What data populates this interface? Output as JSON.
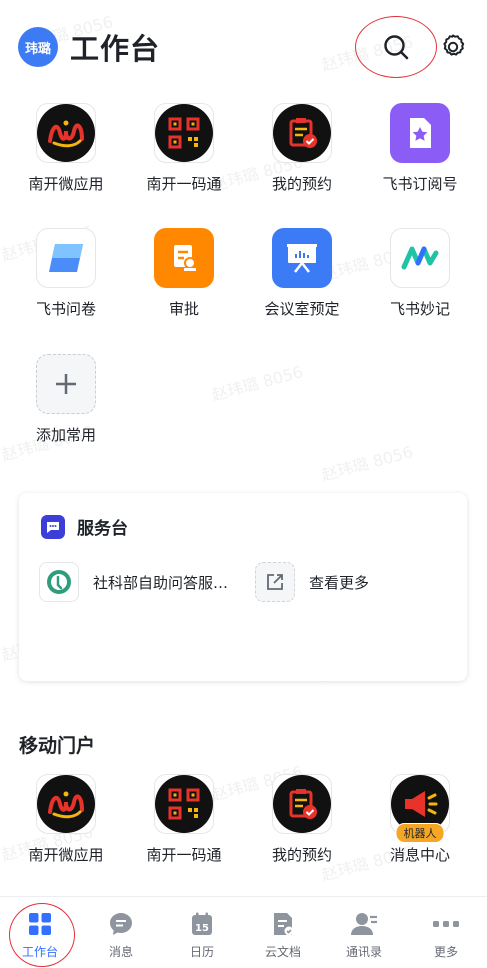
{
  "header": {
    "avatar_text": "玮璐",
    "title": "工作台"
  },
  "watermark": "赵玮璐 8056",
  "favorites": [
    {
      "label": "南开微应用",
      "icon": "nankai-micro-app-icon"
    },
    {
      "label": "南开一码通",
      "icon": "qr-code-icon"
    },
    {
      "label": "我的预约",
      "icon": "clipboard-check-icon"
    },
    {
      "label": "飞书订阅号",
      "icon": "subscription-star-icon"
    },
    {
      "label": "飞书问卷",
      "icon": "survey-icon"
    },
    {
      "label": "审批",
      "icon": "approval-icon"
    },
    {
      "label": "会议室预定",
      "icon": "meeting-room-icon"
    },
    {
      "label": "飞书妙记",
      "icon": "minutes-icon"
    }
  ],
  "add_favorite": {
    "label": "添加常用"
  },
  "service_desk": {
    "title": "服务台",
    "items": [
      {
        "label": "社科部自助问答服…",
        "icon": "help-bot-icon"
      },
      {
        "label": "查看更多",
        "icon": "external-link-icon"
      }
    ]
  },
  "portal": {
    "title": "移动门户",
    "apps": [
      {
        "label": "南开微应用",
        "icon": "nankai-micro-app-icon"
      },
      {
        "label": "南开一码通",
        "icon": "qr-code-icon"
      },
      {
        "label": "我的预约",
        "icon": "clipboard-check-icon"
      },
      {
        "label": "消息中心",
        "icon": "megaphone-icon",
        "badge": "机器人"
      }
    ]
  },
  "tabbar": {
    "active": "工作台",
    "tabs": [
      {
        "label": "工作台",
        "icon": "workbench-grid-icon"
      },
      {
        "label": "消息",
        "icon": "message-bubble-icon"
      },
      {
        "label": "日历",
        "icon": "calendar-icon",
        "day": "15"
      },
      {
        "label": "云文档",
        "icon": "cloud-doc-icon"
      },
      {
        "label": "通讯录",
        "icon": "contacts-icon"
      },
      {
        "label": "更多",
        "icon": "more-dots-icon"
      }
    ]
  },
  "colors": {
    "accent": "#3370ff",
    "highlight_ring": "#e0343a",
    "app_orange": "#ff8800",
    "app_blue": "#3b7bf5",
    "app_purple": "#8b5cf6"
  }
}
